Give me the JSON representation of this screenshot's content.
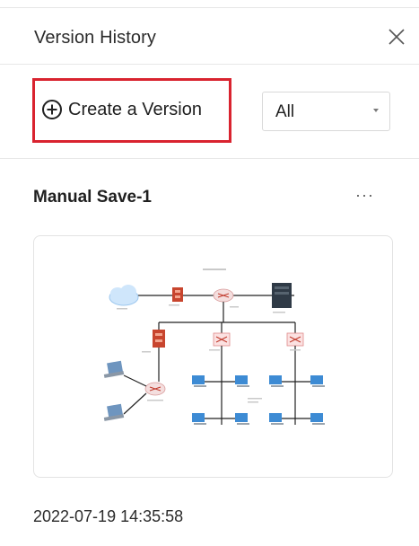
{
  "header": {
    "title": "Version History",
    "close_icon": "close-icon"
  },
  "toolbar": {
    "create_label": "Create a Version",
    "create_icon": "plus-circle-icon",
    "highlight_color": "#d9232f",
    "filter": {
      "selected": "All",
      "icon": "chevron-down-icon"
    }
  },
  "versions": [
    {
      "name": "Manual Save-1",
      "more_label": "···",
      "timestamp": "2022-07-19 14:35:58",
      "thumbnail": {
        "icons": [
          "cloud-icon",
          "firewall-icon",
          "router-icon",
          "server-icon",
          "switch-icon",
          "laptop-icon",
          "computer-icon"
        ]
      }
    }
  ]
}
